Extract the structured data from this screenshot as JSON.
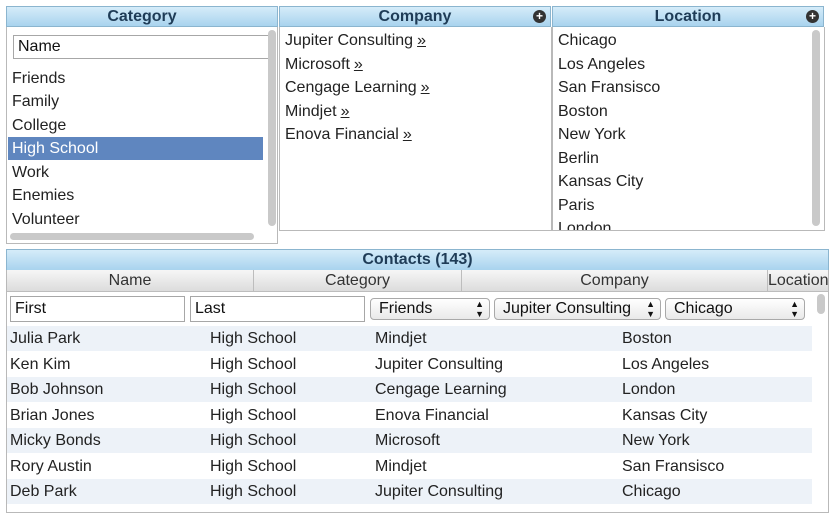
{
  "category": {
    "title": "Category",
    "search_value": "Name",
    "items": [
      "Friends",
      "Family",
      "College",
      "High School",
      "Work",
      "Enemies",
      "Volunteer"
    ],
    "selected": "High School"
  },
  "company": {
    "title": "Company",
    "items": [
      "Jupiter Consulting",
      "Microsoft",
      "Cengage Learning",
      "Mindjet",
      "Enova Financial"
    ],
    "link_suffix": "»"
  },
  "location": {
    "title": "Location",
    "items": [
      "Chicago",
      "Los Angeles",
      "San Fransisco",
      "Boston",
      "New York",
      "Berlin",
      "Kansas City",
      "Paris",
      "London"
    ]
  },
  "contacts": {
    "title": "Contacts (143)",
    "columns": [
      "Name",
      "Category",
      "Company",
      "Location"
    ],
    "filters": {
      "first_value": "First",
      "last_value": "Last",
      "category_selected": "Friends",
      "company_selected": "Jupiter Consulting",
      "location_selected": "Chicago"
    },
    "rows": [
      {
        "name": "Julia Park",
        "category": "High School",
        "company": "Mindjet",
        "location": "Boston"
      },
      {
        "name": "Ken Kim",
        "category": "High School",
        "company": "Jupiter Consulting",
        "location": "Los Angeles"
      },
      {
        "name": "Bob Johnson",
        "category": "High School",
        "company": "Cengage Learning",
        "location": "London"
      },
      {
        "name": "Brian Jones",
        "category": "High School",
        "company": "Enova Financial",
        "location": "Kansas City"
      },
      {
        "name": "Micky Bonds",
        "category": "High School",
        "company": "Microsoft",
        "location": "New York"
      },
      {
        "name": "Rory Austin",
        "category": "High School",
        "company": "Mindjet",
        "location": "San Fransisco"
      },
      {
        "name": "Deb Park",
        "category": "High School",
        "company": "Jupiter Consulting",
        "location": "Chicago"
      }
    ]
  },
  "icons": {
    "plus": "plus-circle-icon",
    "select_arrow": "up-down-arrow-icon"
  }
}
